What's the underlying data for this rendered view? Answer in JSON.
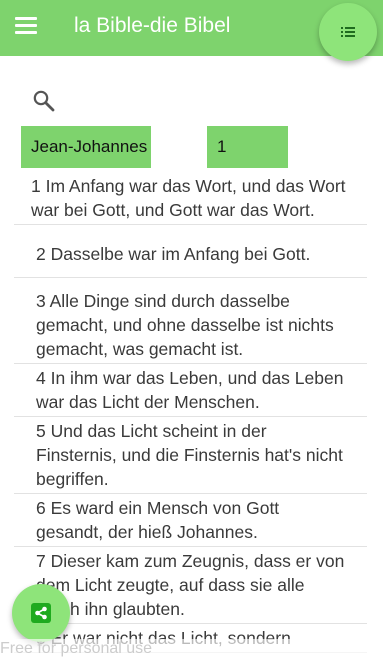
{
  "app_title": "la Bible-die Bibel",
  "colors": {
    "appbar": "#7ed36d",
    "fab": "#8ee47a",
    "field": "#7ed36d",
    "share_icon_bg": "#1faa1f"
  },
  "icons": {
    "menu": "hamburger-menu-icon",
    "list": "list-icon",
    "search": "search-icon",
    "share": "share-icon"
  },
  "book_field": {
    "value": "Jean-Johannes"
  },
  "chapter_field": {
    "value": "1"
  },
  "verses": [
    "1 Im Anfang war das Wort, und das Wort war bei Gott, und Gott war das Wort.",
    "2 Dasselbe war im Anfang bei Gott.",
    "3 Alle Dinge sind durch dasselbe gemacht, und ohne dasselbe ist nichts gemacht, was gemacht ist.",
    "4 In ihm war das Leben, und das Leben war das Licht der Menschen.",
    "5 Und das Licht scheint in der Finsternis, und die Finsternis hat's nicht begriffen.",
    "6 Es ward ein Mensch von Gott gesandt, der hieß Johannes.",
    "7 Dieser kam zum Zeugnis, dass er von dem Licht zeugte, auf dass sie alle durch ihn glaubten.",
    "8 Er war nicht das Licht, sondern"
  ],
  "watermark": "Free for personal use"
}
